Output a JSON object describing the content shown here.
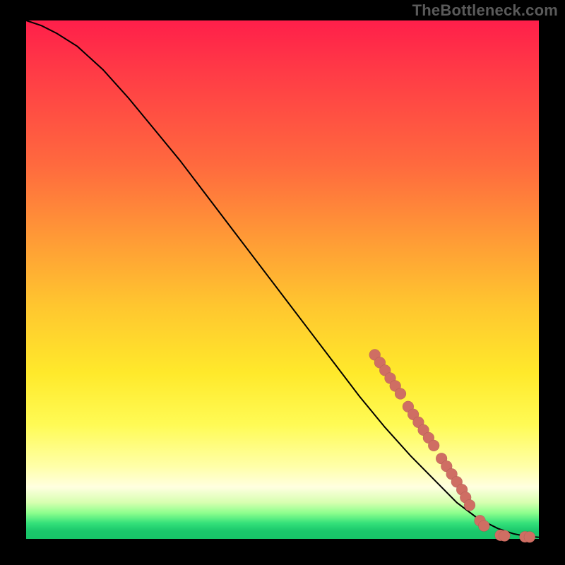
{
  "watermark": "TheBottleneck.com",
  "colors": {
    "page_bg": "#000000",
    "watermark": "#5a5a5a",
    "curve": "#000000",
    "dot_fill": "#cf6e63"
  },
  "chart_data": {
    "type": "line",
    "title": "",
    "xlabel": "",
    "ylabel": "",
    "xlim": [
      0,
      100
    ],
    "ylim": [
      0,
      100
    ],
    "grid": false,
    "legend": false,
    "series": [
      {
        "name": "bottleneck-curve",
        "x": [
          0,
          3,
          6,
          10,
          15,
          20,
          25,
          30,
          35,
          40,
          45,
          50,
          55,
          60,
          65,
          70,
          75,
          80,
          84,
          88,
          92,
          95,
          97,
          99,
          100
        ],
        "y": [
          100,
          99,
          97.5,
          95,
          90.5,
          85,
          79,
          73,
          66.5,
          60,
          53.5,
          47,
          40.5,
          34,
          27.5,
          21.5,
          16,
          11,
          7,
          4,
          2,
          1,
          0.6,
          0.4,
          0.3
        ]
      }
    ],
    "points": [
      {
        "x": 68,
        "y": 35.5
      },
      {
        "x": 69,
        "y": 34
      },
      {
        "x": 70,
        "y": 32.5
      },
      {
        "x": 71,
        "y": 31
      },
      {
        "x": 72,
        "y": 29.5
      },
      {
        "x": 73,
        "y": 28
      },
      {
        "x": 74.5,
        "y": 25.5
      },
      {
        "x": 75.5,
        "y": 24
      },
      {
        "x": 76.5,
        "y": 22.5
      },
      {
        "x": 77.5,
        "y": 21
      },
      {
        "x": 78.5,
        "y": 19.5
      },
      {
        "x": 79.5,
        "y": 18
      },
      {
        "x": 81,
        "y": 15.5
      },
      {
        "x": 82,
        "y": 14
      },
      {
        "x": 83,
        "y": 12.5
      },
      {
        "x": 84,
        "y": 11
      },
      {
        "x": 85,
        "y": 9.5
      },
      {
        "x": 85.7,
        "y": 8
      },
      {
        "x": 86.5,
        "y": 6.5
      },
      {
        "x": 88.5,
        "y": 3.5
      },
      {
        "x": 89.3,
        "y": 2.5
      },
      {
        "x": 92.5,
        "y": 0.7
      },
      {
        "x": 93.3,
        "y": 0.6
      },
      {
        "x": 97.3,
        "y": 0.4
      },
      {
        "x": 98.2,
        "y": 0.35
      }
    ],
    "dot_radius_percent": 1.1
  }
}
